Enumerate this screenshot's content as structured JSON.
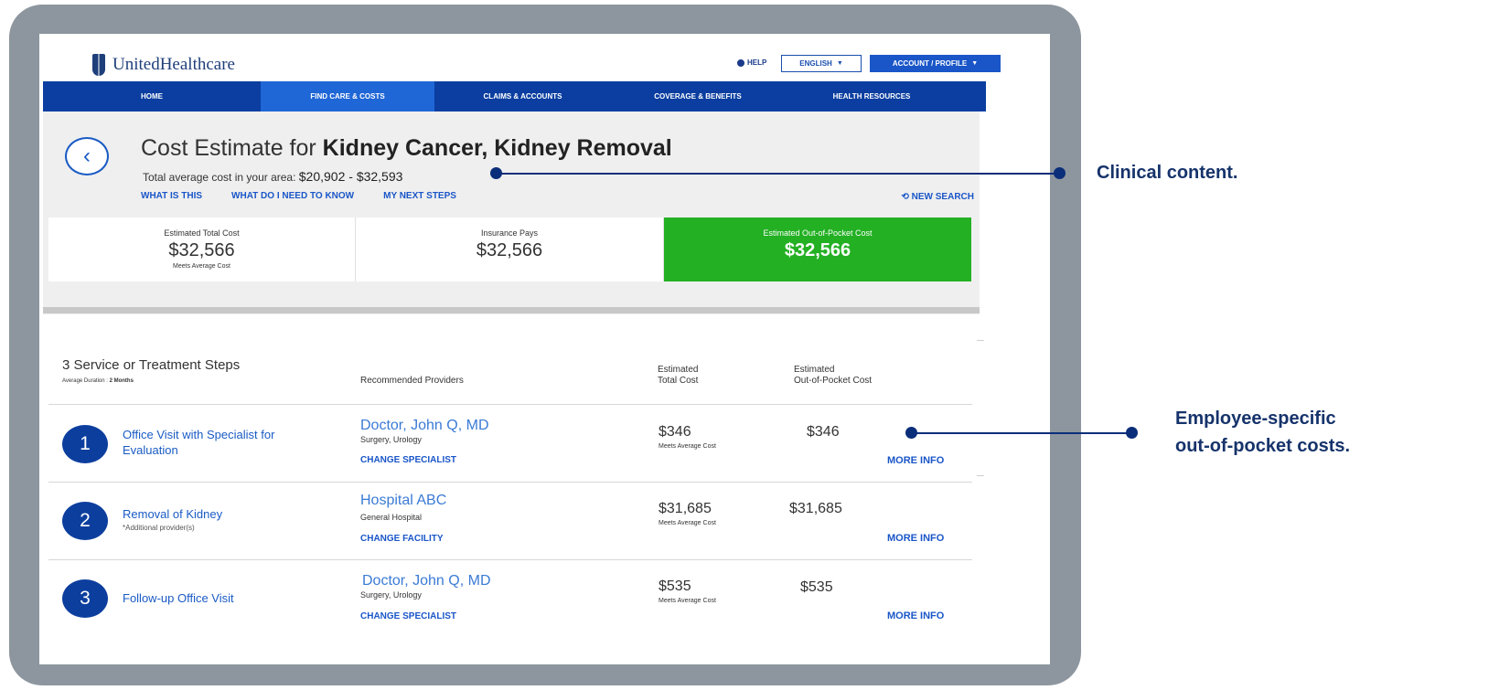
{
  "header": {
    "brand": "UnitedHealthcare",
    "help_label": "HELP",
    "language_label": "ENGLISH",
    "account_label": "ACCOUNT / PROFILE"
  },
  "nav": {
    "items": [
      {
        "label": "HOME"
      },
      {
        "label": "FIND CARE & COSTS"
      },
      {
        "label": "CLAIMS & ACCOUNTS"
      },
      {
        "label": "COVERAGE & BENEFITS"
      },
      {
        "label": "HEALTH RESOURCES"
      }
    ]
  },
  "estimate": {
    "title_prefix": "Cost Estimate for ",
    "title_bold": "Kidney Cancer, Kidney Removal",
    "avg_label": "Total average cost in your area: ",
    "avg_value": "$20,902 - $32,593",
    "links": [
      "WHAT IS THIS",
      "WHAT DO I NEED TO KNOW",
      "MY NEXT STEPS"
    ],
    "new_search": "NEW SEARCH"
  },
  "cards": [
    {
      "label": "Estimated Total Cost",
      "amount": "$32,566",
      "sub": "Meets Average Cost"
    },
    {
      "label": "Insurance Pays",
      "amount": "$32,566",
      "sub": ""
    },
    {
      "label": "Estimated Out-of-Pocket Cost",
      "amount": "$32,566",
      "sub": ""
    }
  ],
  "steps": {
    "title": "3 Service or Treatment Steps",
    "duration_label": "Average Duration : ",
    "duration_value": "2 Months",
    "col_providers": "Recommended Providers",
    "col_total": [
      "Estimated",
      "Total Cost"
    ],
    "col_oop": [
      "Estimated",
      "Out-of-Pocket Cost"
    ],
    "rows": [
      {
        "num": "1",
        "name": [
          "Office Visit with Specialist for",
          "Evaluation"
        ],
        "note": "",
        "provider": "Doctor, John Q, MD",
        "specialty": "Surgery, Urology",
        "change": "CHANGE SPECIALIST",
        "total": "$346",
        "meets": "Meets Average Cost",
        "oop": "$346",
        "more": "MORE INFO"
      },
      {
        "num": "2",
        "name": [
          "Removal of Kidney"
        ],
        "note": "*Additional provider(s)",
        "provider": "Hospital ABC",
        "specialty": "General Hospital",
        "change": "CHANGE FACILITY",
        "total": "$31,685",
        "meets": "Meets Average Cost",
        "oop": "$31,685",
        "more": "MORE INFO"
      },
      {
        "num": "3",
        "name": [
          "Follow-up Office Visit"
        ],
        "note": "",
        "provider": "Doctor, John Q, MD",
        "specialty": "Surgery, Urology",
        "change": "CHANGE SPECIALIST",
        "total": "$535",
        "meets": "Meets Average Cost",
        "oop": "$535",
        "more": "MORE INFO"
      }
    ]
  },
  "callouts": {
    "clinical": "Clinical content.",
    "employee_line1": "Employee-specific",
    "employee_line2": "out-of-pocket costs."
  },
  "colors": {
    "nav_blue": "#0b3ea0",
    "nav_active": "#1f66d6",
    "oop_green": "#23b023",
    "callout_navy": "#16336b"
  }
}
